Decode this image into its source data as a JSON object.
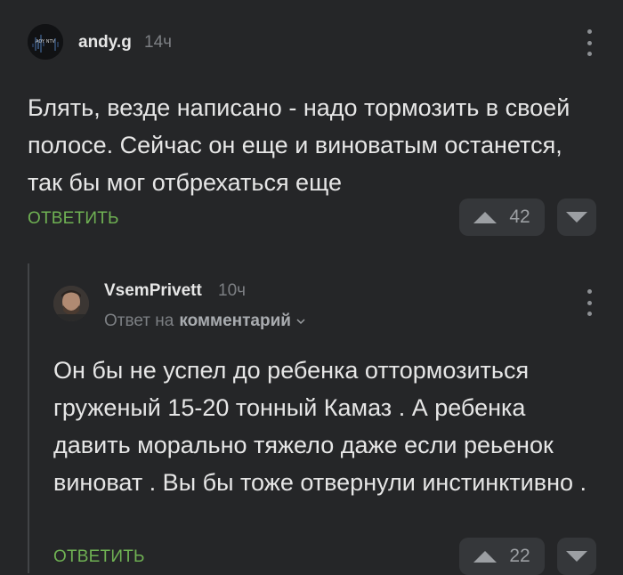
{
  "comments": [
    {
      "author": "andy.g",
      "time": "14ч",
      "avatar_text": "ADY NTV",
      "text": "Блять, везде написано - надо тормозить в своей полосе. Сейчас он еще и виноватым останется, так бы мог отбрехаться еще",
      "reply_label": "ОТВЕТИТЬ",
      "rating": "42"
    },
    {
      "author": "VsemPrivett",
      "time": "10ч",
      "reply_to_prefix": "Ответ на",
      "reply_to_link": "комментарий",
      "text": "Он бы не успел до ребенка оттормозиться груженый 15-20 тонный Камаз . А ребенка давить морально тяжело даже если реьенок виноват . Вы бы тоже отвернули инстинктивно .",
      "reply_label": "ОТВЕТИТЬ",
      "rating": "22"
    }
  ],
  "colors": {
    "background": "#252628",
    "accent_green": "#6fb153",
    "muted": "#7c7f83",
    "button_bg": "#35373a"
  }
}
